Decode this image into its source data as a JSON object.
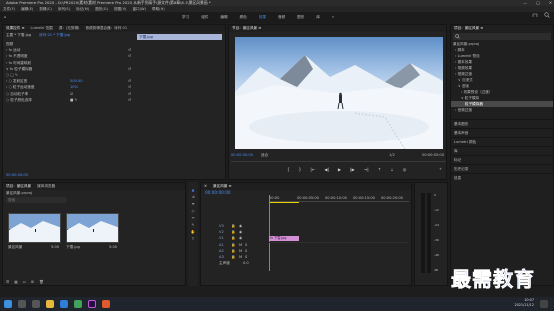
{
  "window": {
    "title": "Adobe Premiere Pro 2020 - D:\\PR2020\\素材\\素材 Premiere Pro 2020 从新手到高手\\源文件\\第8章\\8.1\\景区风景画 *",
    "controls": [
      "—",
      "□",
      "✕"
    ]
  },
  "menu": [
    "文件(F)",
    "编辑(E)",
    "剪辑(C)",
    "序列(S)",
    "标记(M)",
    "图形(G)",
    "视图(V)",
    "窗口(W)",
    "帮助(H)"
  ],
  "workspaces": {
    "home": "⌂",
    "tabs": [
      "学习",
      "组件",
      "编辑",
      "颜色",
      "效果",
      "音频",
      "图形",
      "库"
    ],
    "active": "效果",
    "more": "»"
  },
  "effect_controls": {
    "tabs": [
      "效果控件 ≡",
      "Lumetri 范围",
      "源：(无剪辑)",
      "音频剪辑混合器：序列 01"
    ],
    "master": "主要 * 下雪.jpg",
    "clip_ref": "序列 01 * 下雪.jpg",
    "clip_label": "下雪.jpg",
    "rows": [
      {
        "label": "视频",
        "value": "",
        "blue": false
      },
      {
        "label": "› fx 运动",
        "value": "",
        "blue": false
      },
      {
        "label": "› fx 不透明度",
        "value": "",
        "blue": false
      },
      {
        "label": "› fx 时间重映射",
        "value": "",
        "blue": false
      },
      {
        "label": "∨ fx 粒子模拟器",
        "value": "",
        "blue": false
      },
      {
        "label": "○ □ ✎",
        "value": "",
        "blue": false
      },
      {
        "label": "› ○ 发射区宽",
        "value": "500.00",
        "blue": true
      },
      {
        "label": "› ○ 粒子运动速度",
        "value": "10%",
        "blue": true
      },
      {
        "label": "○ 自动粒子率",
        "value": "☑",
        "blue": false
      },
      {
        "label": "○ 粒子颜色选择",
        "value": "■ ✎",
        "blue": false
      }
    ],
    "timecode": "00:00:00:00"
  },
  "program": {
    "tab": "节目：景区风景 ≡",
    "timecode_in": "00:00:00:00",
    "fit": "适合",
    "quality": "1/2",
    "timecode_out": "00:00:05:00"
  },
  "project": {
    "tab": "项目：景区风景 ≡",
    "items": [
      "景区风景.prproj",
      "› 脚本",
      "› Lumetri 预设",
      "› 基本效果",
      "› 视频效果",
      "› 视频过渡",
      "∨ 沉浸式",
      "∨ 旧版",
      "› 效果预设（过渡）",
      "∨ 粒子模拟",
      "粒子模拟器",
      "› 音频过渡"
    ],
    "selected": 10,
    "sections": [
      "基本图形",
      "基本声音",
      "Lumetri 颜色",
      "库",
      "标记",
      "历史记录",
      "信息"
    ]
  },
  "assets": {
    "tabs": [
      "项目：景区风景",
      "媒体浏览器"
    ],
    "path": "景区风景.prproj",
    "search_placeholder": "搜索",
    "items": [
      {
        "name": "景区风景",
        "dur": "5:00"
      },
      {
        "name": "下雪.jpg",
        "dur": "5:00"
      }
    ]
  },
  "timeline": {
    "tab": "景区风景 ≡",
    "timecode": "00:00:00:00",
    "ruler": [
      "00:00",
      "00:00:05:00",
      "00:00:10:00",
      "00:00:15:00",
      "00:00:20:00"
    ],
    "tracks": [
      "V3",
      "V2",
      "V1",
      "A1",
      "A2",
      "A3",
      "主声道"
    ],
    "master_value": "0.0",
    "clip": "fx 下雪.jpg"
  },
  "meters": {
    "scale": [
      "0",
      "-12",
      "-24",
      "-36",
      "-48",
      "dB"
    ]
  },
  "taskbar": {
    "time": "10:07",
    "date": "2021/11/12"
  },
  "watermark": "最需教育"
}
